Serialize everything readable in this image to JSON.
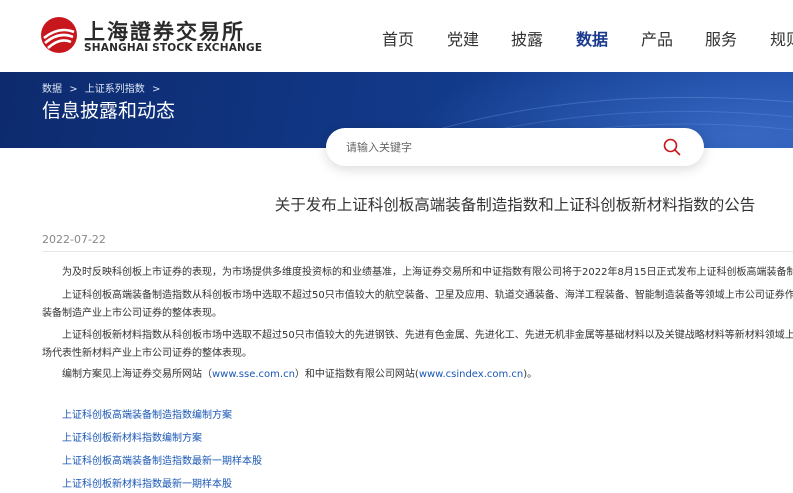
{
  "header": {
    "logo_cn": "上海證券交易所",
    "logo_en": "SHANGHAI STOCK EXCHANGE",
    "nav": [
      {
        "label": "首页"
      },
      {
        "label": "党建"
      },
      {
        "label": "披露"
      },
      {
        "label": "数据",
        "active": true
      },
      {
        "label": "产品"
      },
      {
        "label": "服务"
      },
      {
        "label": "规则"
      }
    ]
  },
  "banner": {
    "breadcrumb": [
      "数据",
      ">",
      "上证系列指数",
      ">"
    ],
    "title": "信息披露和动态"
  },
  "search": {
    "placeholder": "请输入关键字"
  },
  "article": {
    "title": "关于发布上证科创板高端装备制造指数和上证科创板新材料指数的公告",
    "date": "2022-07-22",
    "p1": "为及时反映科创板上市证券的表现，为市场提供多维度投资标的和业绩基准，上海证券交易所和中证指数有限公司将于2022年8月15日正式发布上证科创板高端装备制造指数",
    "p2_line1": "上证科创板高端装备制造指数从科创板市场中选取不超过50只市值较大的航空装备、卫星及应用、轨道交通装备、海洋工程装备、智能制造装备等领域上市公司证券作",
    "p2_line2": "装备制造产业上市公司证券的整体表现。",
    "p3_line1": "上证科创板新材料指数从科创板市场中选取不超过50只市值较大的先进钢铁、先进有色金属、先进化工、先进无机非金属等基础材料以及关键战略材料等新材料领域上",
    "p3_line2": "场代表性新材料产业上市公司证券的整体表现。",
    "p4_prefix": "编制方案见上海证券交易所网站（",
    "p4_link1": "www.sse.com.cn",
    "p4_mid": "）和中证指数有限公司网站(",
    "p4_link2": "www.csindex.com.cn",
    "p4_suffix": ")。",
    "links": [
      "上证科创板高端装备制造指数编制方案",
      "上证科创板新材料指数编制方案",
      "上证科创板高端装备制造指数最新一期样本股",
      "上证科创板新材料指数最新一期样本股"
    ]
  },
  "colors": {
    "brand_red": "#c8161d",
    "nav_active": "#1a3a8f",
    "banner_dark": "#0d2a6e",
    "link_blue": "#1a57b5"
  }
}
